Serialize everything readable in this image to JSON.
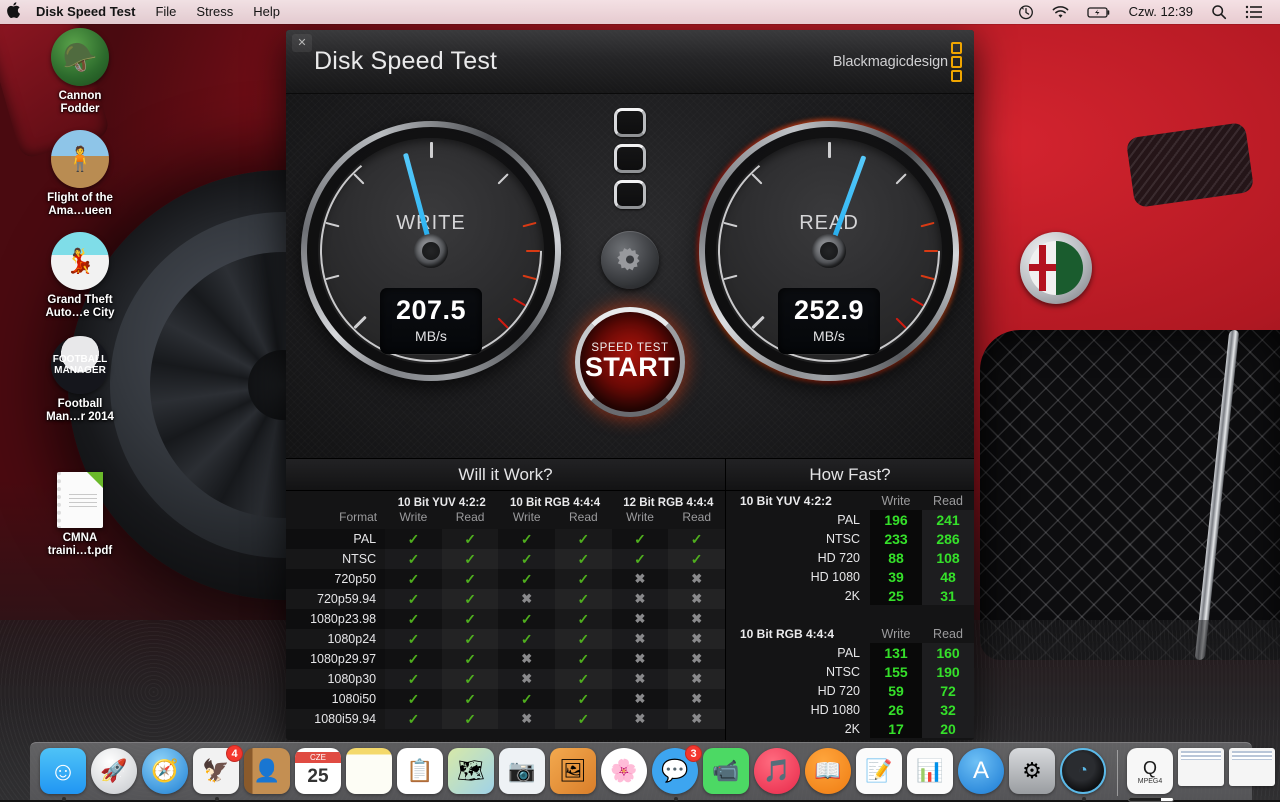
{
  "menubar": {
    "apple_icon": "apple-logo",
    "app_name": "Disk Speed Test",
    "menus": [
      "File",
      "Stress",
      "Help"
    ],
    "status": {
      "time_machine_icon": "clock-arrow-icon",
      "wifi_icon": "wifi-icon",
      "battery_icon": "battery-charging-icon",
      "clock": "Czw. 12:39",
      "search_icon": "search-icon",
      "notifications_icon": "list-lines-icon"
    }
  },
  "window": {
    "close_label": "✕",
    "title": "Disk Speed Test",
    "brand": "Blackmagicdesign"
  },
  "gauges": {
    "write": {
      "label": "WRITE",
      "value": "207.5",
      "unit": "MB/s",
      "needle_deg": -15
    },
    "read": {
      "label": "READ",
      "value": "252.9",
      "unit": "MB/s",
      "needle_deg": 20
    }
  },
  "center": {
    "indicator_count": 3,
    "gear_icon": "gear-icon",
    "start_sub": "SPEED TEST",
    "start_main": "START"
  },
  "will_it_work": {
    "title": "Will it Work?",
    "group_headers": [
      "10 Bit YUV 4:2:2",
      "10 Bit RGB 4:4:4",
      "12 Bit RGB 4:4:4"
    ],
    "sub_headers": [
      "Format",
      "Write",
      "Read",
      "Write",
      "Read",
      "Write",
      "Read"
    ],
    "ok_glyph": "✓",
    "no_glyph": "✖",
    "rows": [
      {
        "format": "PAL",
        "cells": [
          true,
          true,
          true,
          true,
          true,
          true
        ]
      },
      {
        "format": "NTSC",
        "cells": [
          true,
          true,
          true,
          true,
          true,
          true
        ]
      },
      {
        "format": "720p50",
        "cells": [
          true,
          true,
          true,
          true,
          false,
          false
        ]
      },
      {
        "format": "720p59.94",
        "cells": [
          true,
          true,
          false,
          true,
          false,
          false
        ]
      },
      {
        "format": "1080p23.98",
        "cells": [
          true,
          true,
          true,
          true,
          false,
          false
        ]
      },
      {
        "format": "1080p24",
        "cells": [
          true,
          true,
          true,
          true,
          false,
          false
        ]
      },
      {
        "format": "1080p29.97",
        "cells": [
          true,
          true,
          false,
          true,
          false,
          false
        ]
      },
      {
        "format": "1080p30",
        "cells": [
          true,
          true,
          false,
          true,
          false,
          false
        ]
      },
      {
        "format": "1080i50",
        "cells": [
          true,
          true,
          true,
          true,
          false,
          false
        ]
      },
      {
        "format": "1080i59.94",
        "cells": [
          true,
          true,
          false,
          true,
          false,
          false
        ]
      }
    ]
  },
  "how_fast": {
    "title": "How Fast?",
    "write_header": "Write",
    "read_header": "Read",
    "groups": [
      {
        "name": "10 Bit YUV 4:2:2",
        "rows": [
          {
            "label": "PAL",
            "write": "196",
            "read": "241"
          },
          {
            "label": "NTSC",
            "write": "233",
            "read": "286"
          },
          {
            "label": "HD 720",
            "write": "88",
            "read": "108"
          },
          {
            "label": "HD 1080",
            "write": "39",
            "read": "48"
          },
          {
            "label": "2K",
            "write": "25",
            "read": "31"
          }
        ]
      },
      {
        "name": "10 Bit RGB 4:4:4",
        "rows": [
          {
            "label": "PAL",
            "write": "131",
            "read": "160"
          },
          {
            "label": "NTSC",
            "write": "155",
            "read": "190"
          },
          {
            "label": "HD 720",
            "write": "59",
            "read": "72"
          },
          {
            "label": "HD 1080",
            "write": "26",
            "read": "32"
          },
          {
            "label": "2K",
            "write": "17",
            "read": "20"
          }
        ]
      }
    ]
  },
  "desktop_icons": [
    {
      "name": "Cannon\nFodder",
      "label": "Cannon Fodder",
      "line1": "Cannon",
      "line2": "Fodder",
      "icon": "game-app-icon",
      "color": "#2f7d3a"
    },
    {
      "name": "Flight of the Ama…ueen",
      "label": "Flight of the Ama…ueen",
      "line1": "Flight of the",
      "line2": "Ama…ueen",
      "icon": "game-app-icon",
      "color": "#c08a4a"
    },
    {
      "name": "Grand Theft Auto…e City",
      "label": "Grand Theft Auto…e City",
      "line1": "Grand Theft",
      "line2": "Auto…e City",
      "icon": "game-app-icon",
      "color": "#111111"
    },
    {
      "name": "Football Man…r 2014",
      "label": "Football Man…r 2014",
      "line1": "Football",
      "line2": "Man…r 2014",
      "icon": "game-app-icon",
      "color": "#1a1a22"
    },
    {
      "name": "CMNA traini…t.pdf",
      "label": "CMNA traini…t.pdf",
      "line1": "CMNA",
      "line2": "traini…t.pdf",
      "icon": "pdf-file-icon",
      "color": "#ffffff"
    }
  ],
  "dock": {
    "items": [
      {
        "name": "finder",
        "icon": "finder-icon",
        "running": true,
        "badge": ""
      },
      {
        "name": "launchpad",
        "icon": "rocket-icon",
        "running": false,
        "badge": ""
      },
      {
        "name": "safari",
        "icon": "compass-icon",
        "running": false,
        "badge": ""
      },
      {
        "name": "mail",
        "icon": "stamp-icon",
        "running": true,
        "badge": "4"
      },
      {
        "name": "contacts",
        "icon": "address-book-icon",
        "running": false,
        "badge": ""
      },
      {
        "name": "calendar",
        "icon": "calendar-icon",
        "running": false,
        "badge": "",
        "cal_month": "CZE",
        "cal_day": "25"
      },
      {
        "name": "notes",
        "icon": "notepad-icon",
        "running": false,
        "badge": ""
      },
      {
        "name": "reminders",
        "icon": "reminders-icon",
        "running": false,
        "badge": ""
      },
      {
        "name": "maps",
        "icon": "map-icon",
        "running": false,
        "badge": ""
      },
      {
        "name": "photo-booth",
        "icon": "photo-camera-icon",
        "running": false,
        "badge": ""
      },
      {
        "name": "preview",
        "icon": "picture-pencil-icon",
        "running": false,
        "badge": ""
      },
      {
        "name": "photos",
        "icon": "flower-icon",
        "running": false,
        "badge": ""
      },
      {
        "name": "messages",
        "icon": "speech-bubble-icon",
        "running": true,
        "badge": "3"
      },
      {
        "name": "facetime",
        "icon": "video-phone-icon",
        "running": false,
        "badge": ""
      },
      {
        "name": "itunes",
        "icon": "music-note-icon",
        "running": false,
        "badge": ""
      },
      {
        "name": "ibooks",
        "icon": "open-book-icon",
        "running": false,
        "badge": ""
      },
      {
        "name": "pages",
        "icon": "document-pen-icon",
        "running": false,
        "badge": ""
      },
      {
        "name": "numbers",
        "icon": "bar-chart-icon",
        "running": false,
        "badge": ""
      },
      {
        "name": "app-store",
        "icon": "app-store-a-icon",
        "running": false,
        "badge": ""
      },
      {
        "name": "system-preferences",
        "icon": "gears-icon",
        "running": false,
        "badge": ""
      },
      {
        "name": "disk-speed-test",
        "icon": "speedometer-icon",
        "running": true,
        "badge": ""
      }
    ],
    "minimized": [
      {
        "name": "mpeg4-file",
        "icon": "mpeg4-file-icon",
        "label": "MPEG4"
      },
      {
        "name": "minimized-window-1",
        "icon": "window-icon"
      },
      {
        "name": "minimized-window-2",
        "icon": "window-icon"
      }
    ],
    "trash": {
      "name": "trash",
      "icon": "trash-icon"
    }
  }
}
